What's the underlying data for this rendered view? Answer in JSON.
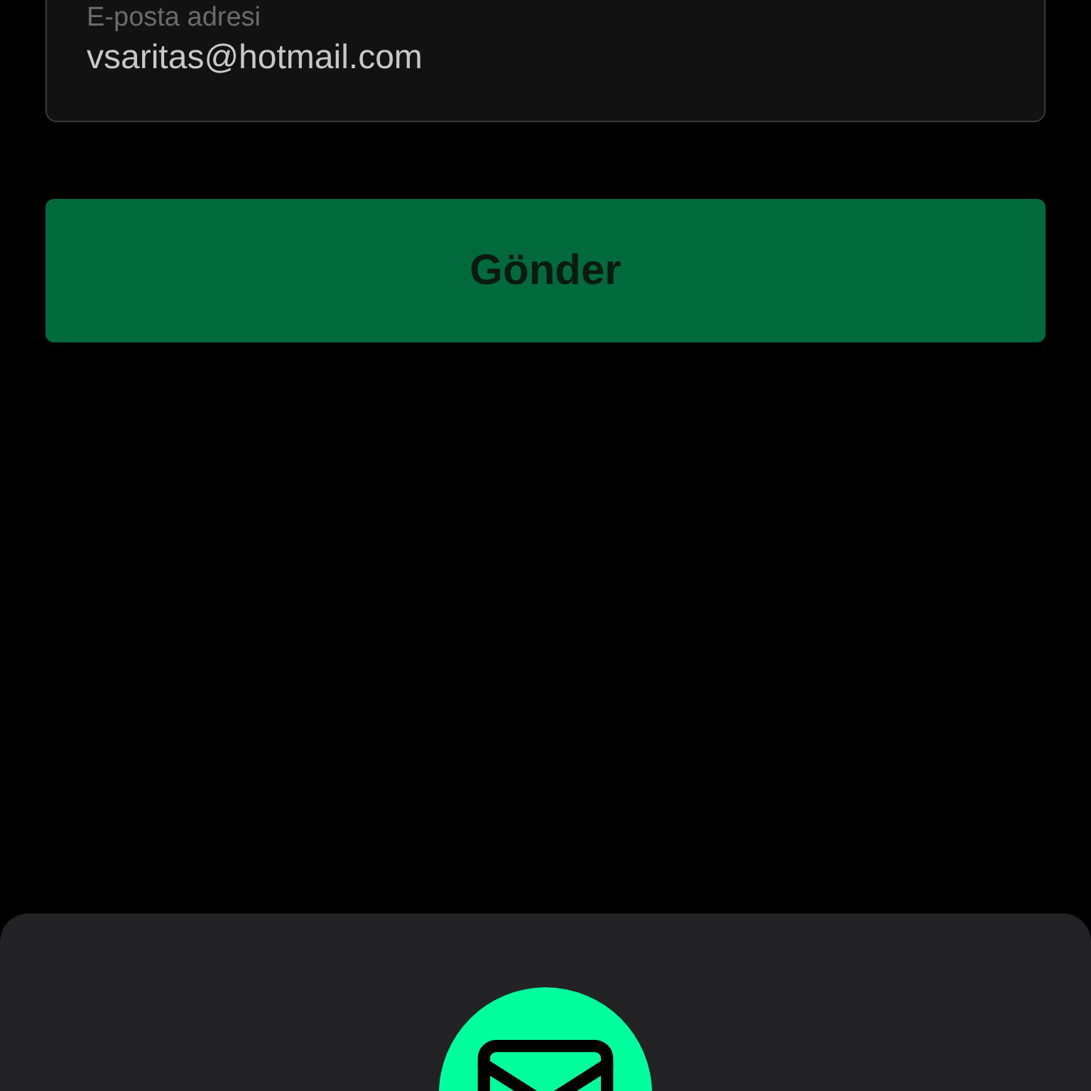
{
  "email_field": {
    "label": "E-posta adresi",
    "value": "vsaritas@hotmail.com"
  },
  "submit_button": {
    "label": "Gönder"
  }
}
